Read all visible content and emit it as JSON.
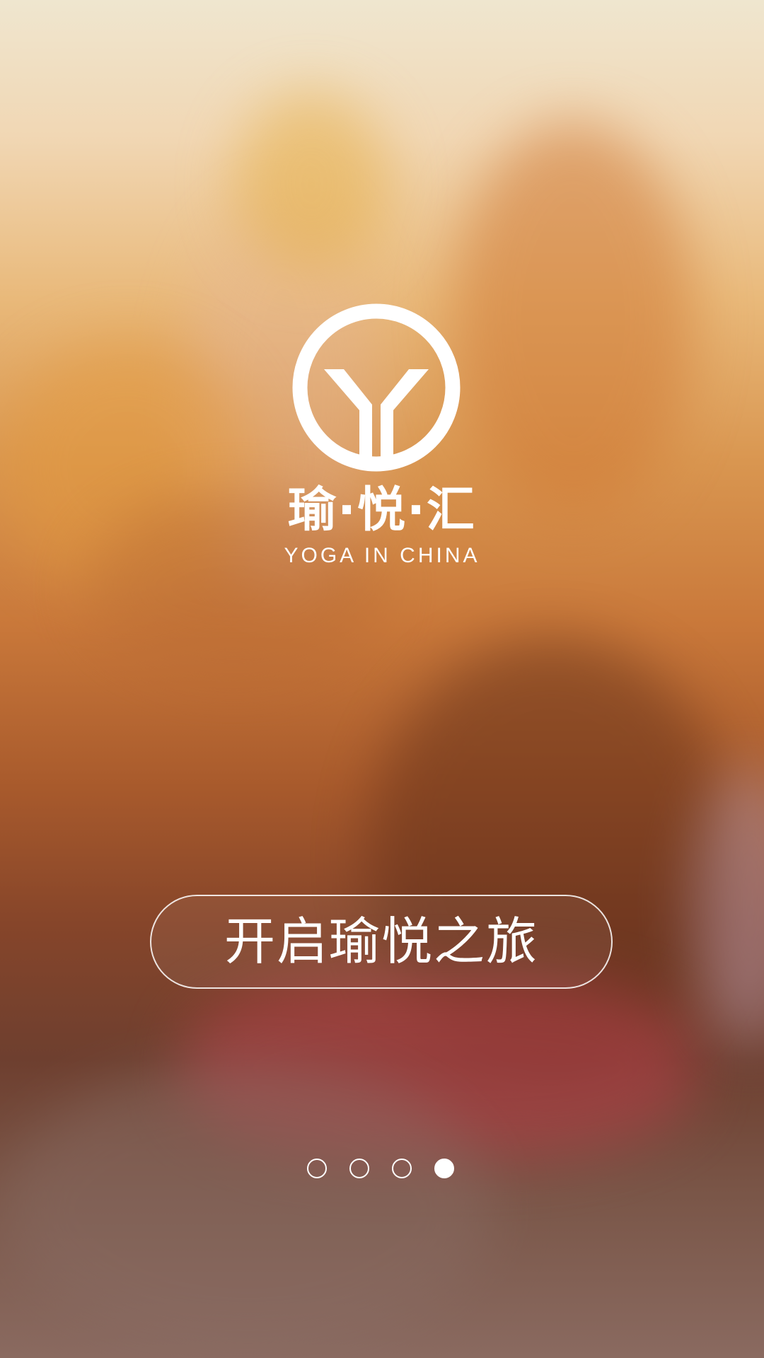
{
  "brand": {
    "name_cn": "瑜·悦·汇",
    "name_en": "YOGA IN CHINA",
    "logo_icon": "yoga-circle-y-logo"
  },
  "cta": {
    "label": "开启瑜悦之旅"
  },
  "pager": {
    "total": 4,
    "current": 4
  },
  "colors": {
    "text": "#ffffff",
    "button_border": "#ffffff",
    "background_top": "#efe6cf",
    "background_mid": "#c9783a",
    "background_bottom": "#8a6a60"
  }
}
